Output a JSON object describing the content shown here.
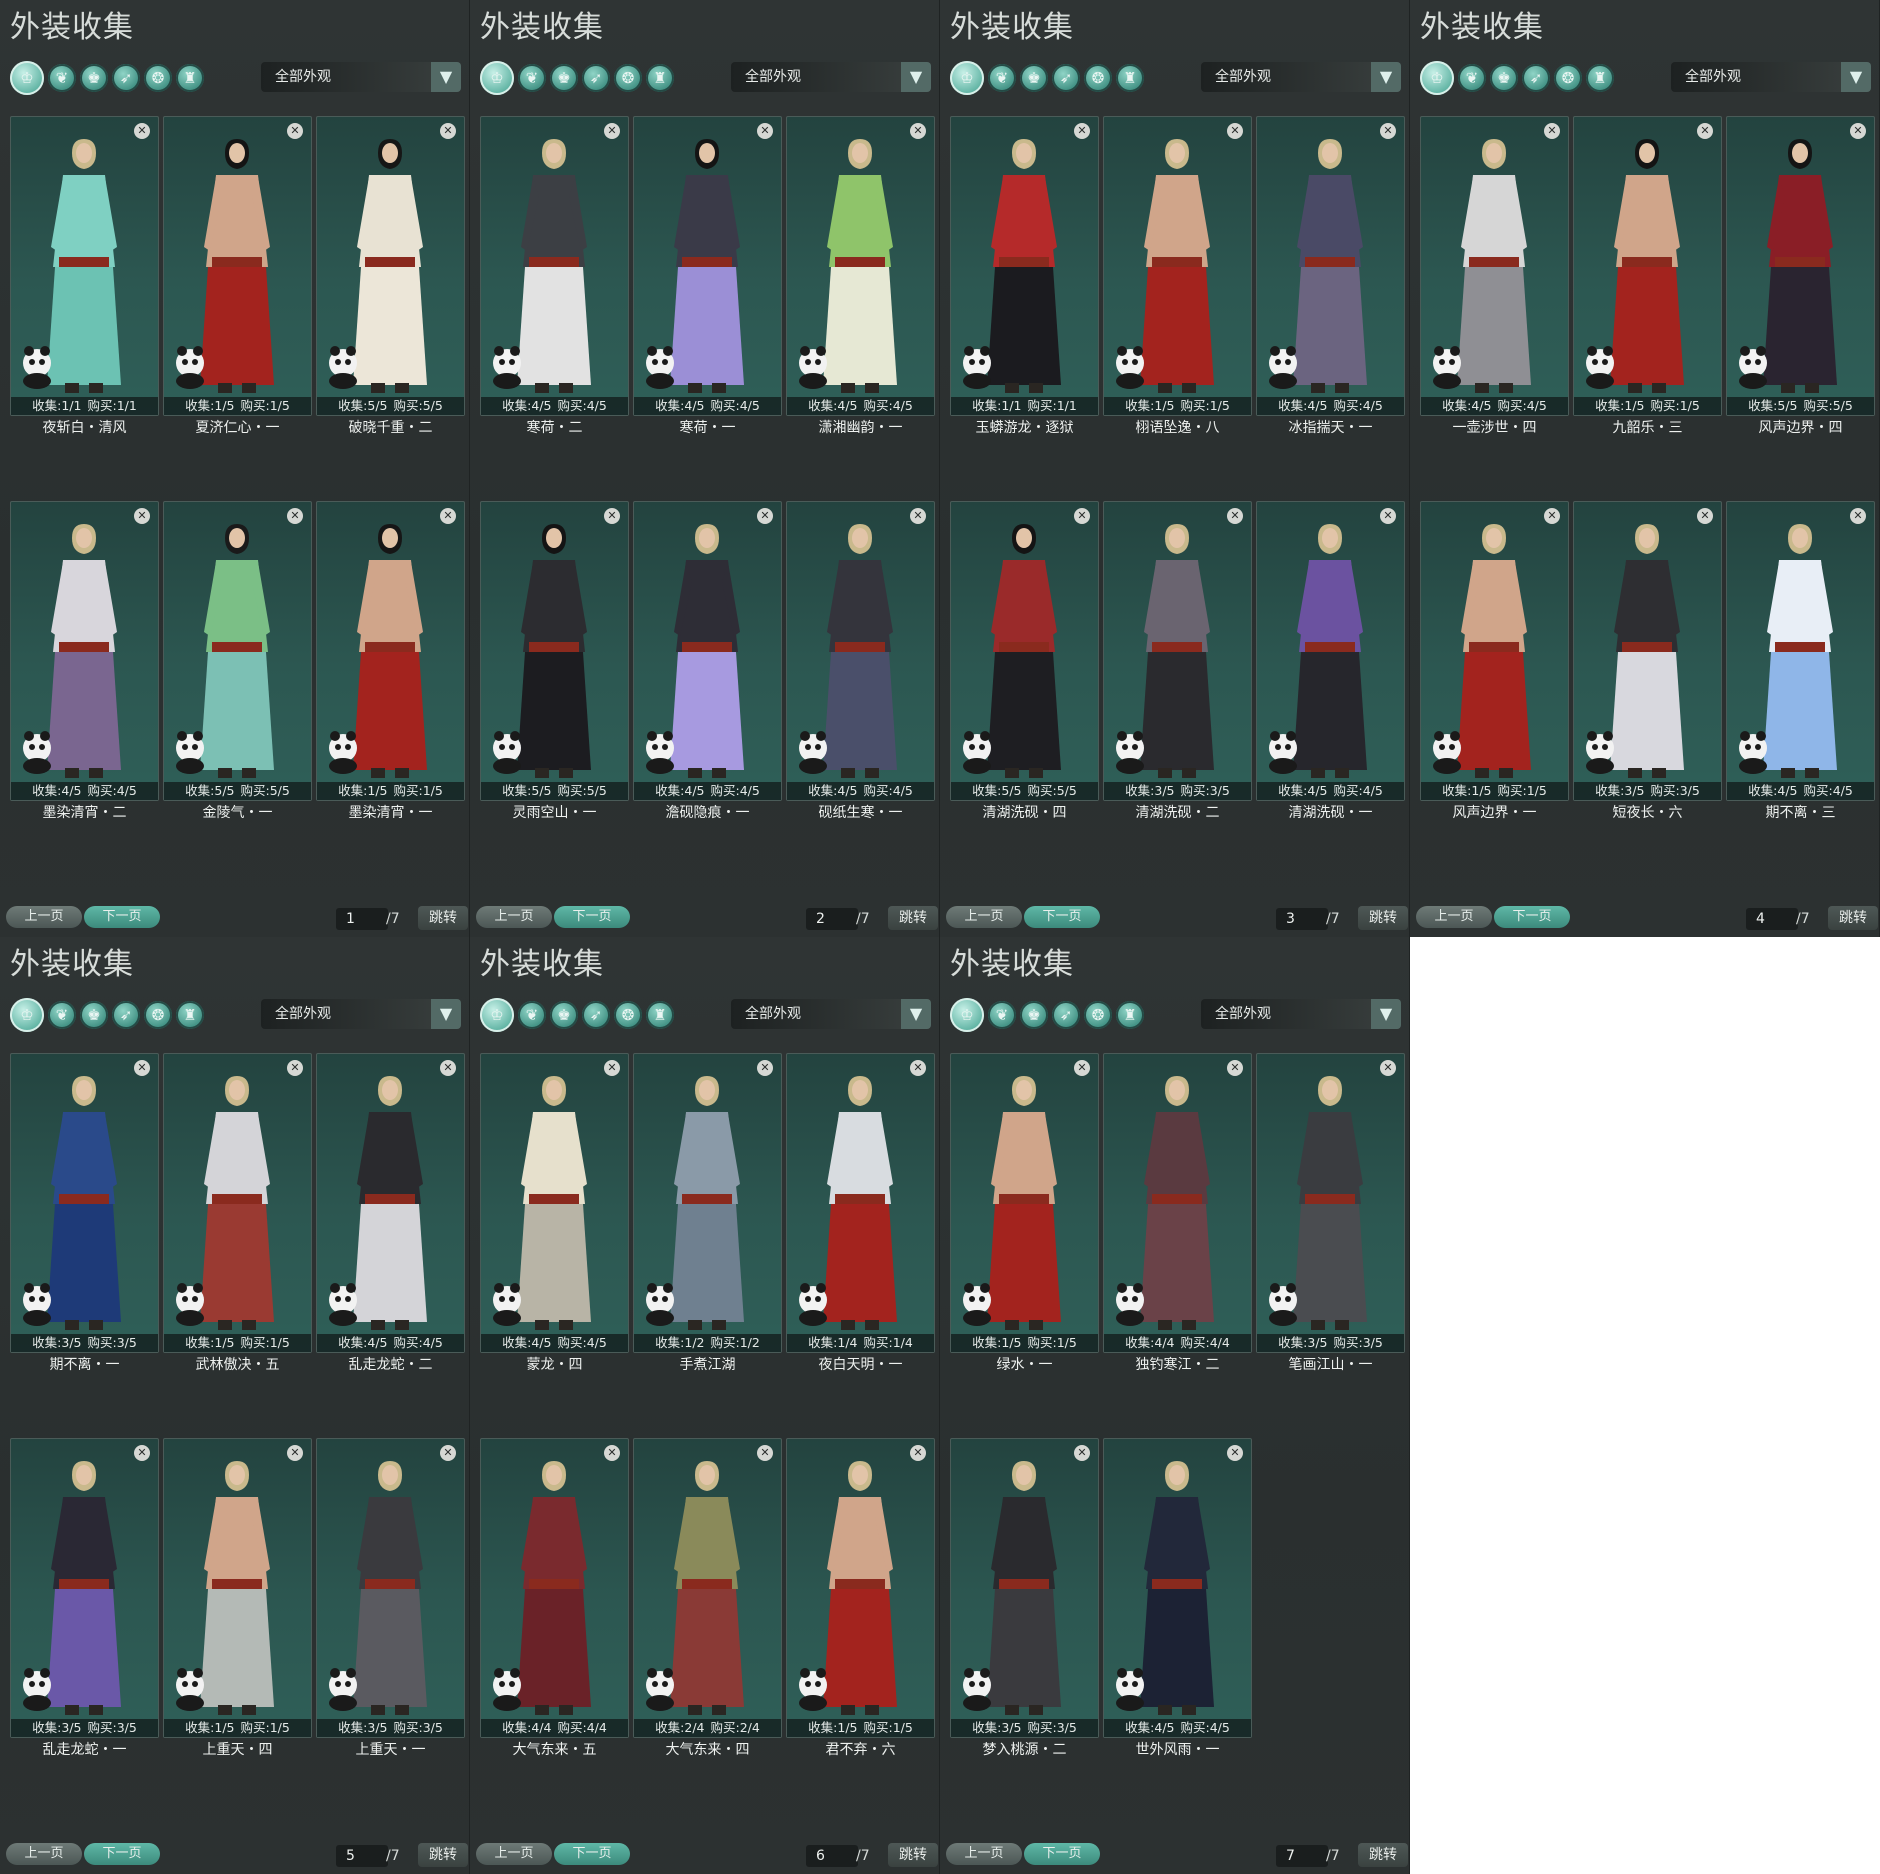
{
  "panel_title": "外装收集",
  "tab_icons": [
    "robe-tab-icon",
    "outfit-tab-icon",
    "armor-tab-icon",
    "shoe-tab-icon",
    "mask-tab-icon",
    "accessory-tab-icon"
  ],
  "filter_label": "全部外观",
  "pager": {
    "prev_label": "上一页",
    "next_label": "下一页",
    "jump_label": "跳转",
    "total_label": "/7"
  },
  "stat_labels": {
    "collect": "收集",
    "buy": "购买"
  },
  "colors": {
    "accent": "#5fb8a7",
    "panel_bg": "#2f3434",
    "card_bg": "#2c5751"
  },
  "pages": [
    {
      "page": "1",
      "items": [
        {
          "name": "夜斩白・清风",
          "collect": "1/1",
          "buy": "1/1",
          "top": "#7fd0c2",
          "bottom": "#6cc2b3",
          "hair": "#c9b98c"
        },
        {
          "name": "夏济仁心・一",
          "collect": "1/5",
          "buy": "1/5",
          "top": "#d0a58a",
          "bottom": "#a3231e",
          "hair": "#141414"
        },
        {
          "name": "破晓千重・二",
          "collect": "5/5",
          "buy": "5/5",
          "top": "#e8e2d3",
          "bottom": "#ece6d8",
          "hair": "#161616"
        },
        {
          "name": "墨染清宵・二",
          "collect": "4/5",
          "buy": "4/5",
          "top": "#d8d6dc",
          "bottom": "#7a6690",
          "hair": "#c9b98c"
        },
        {
          "name": "金陵气・一",
          "collect": "5/5",
          "buy": "5/5",
          "top": "#7bbf86",
          "bottom": "#7cc0b4",
          "hair": "#1a1a1a"
        },
        {
          "name": "墨染清宵・一",
          "collect": "1/5",
          "buy": "1/5",
          "top": "#d0a58a",
          "bottom": "#a3231e",
          "hair": "#161616"
        }
      ]
    },
    {
      "page": "2",
      "items": [
        {
          "name": "寒荷・二",
          "collect": "4/5",
          "buy": "4/5",
          "top": "#3c3f44",
          "bottom": "#e2e2e2",
          "hair": "#c9b98c"
        },
        {
          "name": "寒荷・一",
          "collect": "4/5",
          "buy": "4/5",
          "top": "#3a3a48",
          "bottom": "#9b8fd6",
          "hair": "#141414"
        },
        {
          "name": "潇湘幽韵・一",
          "collect": "4/5",
          "buy": "4/5",
          "top": "#8fc46a",
          "bottom": "#e6e8d4",
          "hair": "#c9b98c"
        },
        {
          "name": "灵雨空山・一",
          "collect": "5/5",
          "buy": "5/5",
          "top": "#2c2c30",
          "bottom": "#1c1c20",
          "hair": "#141414"
        },
        {
          "name": "澹砚隐痕・一",
          "collect": "4/5",
          "buy": "4/5",
          "top": "#2e2d36",
          "bottom": "#a79ae0",
          "hair": "#c9b98c"
        },
        {
          "name": "砚纸生寒・一",
          "collect": "4/5",
          "buy": "4/5",
          "top": "#34343c",
          "bottom": "#4a4f6a",
          "hair": "#c9b98c"
        }
      ]
    },
    {
      "page": "3",
      "items": [
        {
          "name": "玉蟒游龙・逐狱",
          "collect": "1/1",
          "buy": "1/1",
          "top": "#b52a2a",
          "bottom": "#1b1b1f",
          "hair": "#c9b98c"
        },
        {
          "name": "栩语坠逸・八",
          "collect": "1/5",
          "buy": "1/5",
          "top": "#d0a58a",
          "bottom": "#a3231e",
          "hair": "#c9b98c"
        },
        {
          "name": "冰指揣天・一",
          "collect": "4/5",
          "buy": "4/5",
          "top": "#4a4a66",
          "bottom": "#6b6480",
          "hair": "#c9b98c"
        },
        {
          "name": "清湖洗砚・四",
          "collect": "5/5",
          "buy": "5/5",
          "top": "#9a2a2a",
          "bottom": "#1e1e22",
          "hair": "#141414"
        },
        {
          "name": "清湖洗砚・二",
          "collect": "3/5",
          "buy": "3/5",
          "top": "#6a6470",
          "bottom": "#2a2a2e",
          "hair": "#c9b98c"
        },
        {
          "name": "清湖洗砚・一",
          "collect": "4/5",
          "buy": "4/5",
          "top": "#6b52a0",
          "bottom": "#26262c",
          "hair": "#c9b98c"
        }
      ]
    },
    {
      "page": "4",
      "items": [
        {
          "name": "一壶涉世・四",
          "collect": "4/5",
          "buy": "4/5",
          "top": "#d6d6d6",
          "bottom": "#8f8f94",
          "hair": "#c9b98c"
        },
        {
          "name": "九韶乐・三",
          "collect": "1/5",
          "buy": "1/5",
          "top": "#d0a58a",
          "bottom": "#a3231e",
          "hair": "#141414"
        },
        {
          "name": "风声边界・四",
          "collect": "5/5",
          "buy": "5/5",
          "top": "#8a1e26",
          "bottom": "#2a2430",
          "hair": "#141414"
        },
        {
          "name": "风声边界・一",
          "collect": "1/5",
          "buy": "1/5",
          "top": "#d0a58a",
          "bottom": "#a3231e",
          "hair": "#c9b98c"
        },
        {
          "name": "短夜长・六",
          "collect": "3/5",
          "buy": "3/5",
          "top": "#2e2e32",
          "bottom": "#d8d8de",
          "hair": "#c9b98c"
        },
        {
          "name": "期不离・三",
          "collect": "4/5",
          "buy": "4/5",
          "top": "#e8eef6",
          "bottom": "#8fb6e8",
          "hair": "#c9b98c"
        }
      ]
    },
    {
      "page": "5",
      "items": [
        {
          "name": "期不离・一",
          "collect": "3/5",
          "buy": "3/5",
          "top": "#2a4a8a",
          "bottom": "#1e3a78",
          "hair": "#c9b98c"
        },
        {
          "name": "武林傲决・五",
          "collect": "1/5",
          "buy": "1/5",
          "top": "#d4d4d8",
          "bottom": "#9a3a32",
          "hair": "#c9b98c"
        },
        {
          "name": "乱走龙蛇・二",
          "collect": "4/5",
          "buy": "4/5",
          "top": "#2a2a2e",
          "bottom": "#d4d4d8",
          "hair": "#c9b98c"
        },
        {
          "name": "乱走龙蛇・一",
          "collect": "3/5",
          "buy": "3/5",
          "top": "#2a2834",
          "bottom": "#6a58a8",
          "hair": "#c9b98c"
        },
        {
          "name": "上重天・四",
          "collect": "1/5",
          "buy": "1/5",
          "top": "#d0a58a",
          "bottom": "#b4bab6",
          "hair": "#c9b98c"
        },
        {
          "name": "上重天・一",
          "collect": "3/5",
          "buy": "3/5",
          "top": "#3a3a3e",
          "bottom": "#5a5a60",
          "hair": "#c9b98c"
        }
      ]
    },
    {
      "page": "6",
      "items": [
        {
          "name": "蒙龙・四",
          "collect": "4/5",
          "buy": "4/5",
          "top": "#e6e0cc",
          "bottom": "#b8b4a6",
          "hair": "#c9b98c"
        },
        {
          "name": "手煮江湖",
          "collect": "1/2",
          "buy": "1/2",
          "top": "#8a9aa8",
          "bottom": "#6f8090",
          "hair": "#c9b98c"
        },
        {
          "name": "夜白天明・一",
          "collect": "1/4",
          "buy": "1/4",
          "top": "#d8dce0",
          "bottom": "#a3231e",
          "hair": "#c9b98c"
        },
        {
          "name": "大气东来・五",
          "collect": "4/4",
          "buy": "4/4",
          "top": "#7a2a2e",
          "bottom": "#6a2228",
          "hair": "#c9b98c"
        },
        {
          "name": "大气东来・四",
          "collect": "2/4",
          "buy": "2/4",
          "top": "#8a8a5a",
          "bottom": "#8a3a36",
          "hair": "#c9b98c"
        },
        {
          "name": "君不弃・六",
          "collect": "1/5",
          "buy": "1/5",
          "top": "#d0a58a",
          "bottom": "#a3231e",
          "hair": "#c9b98c"
        }
      ]
    },
    {
      "page": "7",
      "items": [
        {
          "name": "绿水・一",
          "collect": "1/5",
          "buy": "1/5",
          "top": "#d0a58a",
          "bottom": "#a3231e",
          "hair": "#c9b98c"
        },
        {
          "name": "独钓寒江・二",
          "collect": "4/4",
          "buy": "4/4",
          "top": "#5a3a40",
          "bottom": "#6a4248",
          "hair": "#c9b98c"
        },
        {
          "name": "笔画江山・一",
          "collect": "3/5",
          "buy": "3/5",
          "top": "#3a3c40",
          "bottom": "#4a4c50",
          "hair": "#c9b98c"
        },
        {
          "name": "梦入桃源・二",
          "collect": "3/5",
          "buy": "3/5",
          "top": "#2a2a2e",
          "bottom": "#3a3a3e",
          "hair": "#c9b98c"
        },
        {
          "name": "世外风雨・一",
          "collect": "4/5",
          "buy": "4/5",
          "top": "#22283a",
          "bottom": "#1c2234",
          "hair": "#c9b98c"
        }
      ]
    }
  ]
}
